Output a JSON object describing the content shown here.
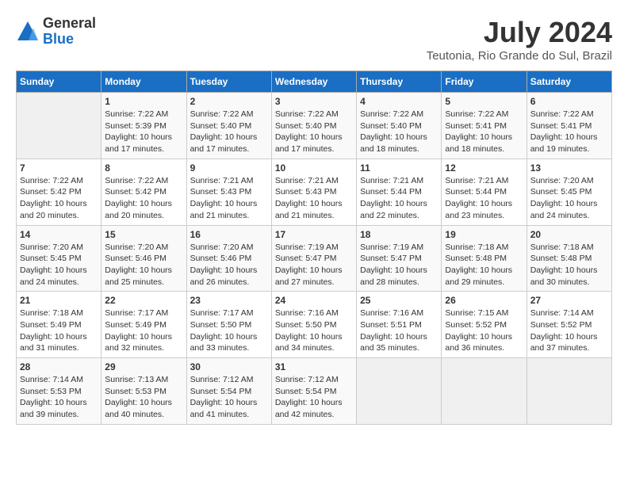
{
  "header": {
    "logo_general": "General",
    "logo_blue": "Blue",
    "month_year": "July 2024",
    "location": "Teutonia, Rio Grande do Sul, Brazil"
  },
  "weekdays": [
    "Sunday",
    "Monday",
    "Tuesday",
    "Wednesday",
    "Thursday",
    "Friday",
    "Saturday"
  ],
  "weeks": [
    [
      {
        "day": "",
        "empty": true
      },
      {
        "day": "1",
        "sunrise": "Sunrise: 7:22 AM",
        "sunset": "Sunset: 5:39 PM",
        "daylight": "Daylight: 10 hours and 17 minutes."
      },
      {
        "day": "2",
        "sunrise": "Sunrise: 7:22 AM",
        "sunset": "Sunset: 5:40 PM",
        "daylight": "Daylight: 10 hours and 17 minutes."
      },
      {
        "day": "3",
        "sunrise": "Sunrise: 7:22 AM",
        "sunset": "Sunset: 5:40 PM",
        "daylight": "Daylight: 10 hours and 17 minutes."
      },
      {
        "day": "4",
        "sunrise": "Sunrise: 7:22 AM",
        "sunset": "Sunset: 5:40 PM",
        "daylight": "Daylight: 10 hours and 18 minutes."
      },
      {
        "day": "5",
        "sunrise": "Sunrise: 7:22 AM",
        "sunset": "Sunset: 5:41 PM",
        "daylight": "Daylight: 10 hours and 18 minutes."
      },
      {
        "day": "6",
        "sunrise": "Sunrise: 7:22 AM",
        "sunset": "Sunset: 5:41 PM",
        "daylight": "Daylight: 10 hours and 19 minutes."
      }
    ],
    [
      {
        "day": "7",
        "sunrise": "Sunrise: 7:22 AM",
        "sunset": "Sunset: 5:42 PM",
        "daylight": "Daylight: 10 hours and 20 minutes."
      },
      {
        "day": "8",
        "sunrise": "Sunrise: 7:22 AM",
        "sunset": "Sunset: 5:42 PM",
        "daylight": "Daylight: 10 hours and 20 minutes."
      },
      {
        "day": "9",
        "sunrise": "Sunrise: 7:21 AM",
        "sunset": "Sunset: 5:43 PM",
        "daylight": "Daylight: 10 hours and 21 minutes."
      },
      {
        "day": "10",
        "sunrise": "Sunrise: 7:21 AM",
        "sunset": "Sunset: 5:43 PM",
        "daylight": "Daylight: 10 hours and 21 minutes."
      },
      {
        "day": "11",
        "sunrise": "Sunrise: 7:21 AM",
        "sunset": "Sunset: 5:44 PM",
        "daylight": "Daylight: 10 hours and 22 minutes."
      },
      {
        "day": "12",
        "sunrise": "Sunrise: 7:21 AM",
        "sunset": "Sunset: 5:44 PM",
        "daylight": "Daylight: 10 hours and 23 minutes."
      },
      {
        "day": "13",
        "sunrise": "Sunrise: 7:20 AM",
        "sunset": "Sunset: 5:45 PM",
        "daylight": "Daylight: 10 hours and 24 minutes."
      }
    ],
    [
      {
        "day": "14",
        "sunrise": "Sunrise: 7:20 AM",
        "sunset": "Sunset: 5:45 PM",
        "daylight": "Daylight: 10 hours and 24 minutes."
      },
      {
        "day": "15",
        "sunrise": "Sunrise: 7:20 AM",
        "sunset": "Sunset: 5:46 PM",
        "daylight": "Daylight: 10 hours and 25 minutes."
      },
      {
        "day": "16",
        "sunrise": "Sunrise: 7:20 AM",
        "sunset": "Sunset: 5:46 PM",
        "daylight": "Daylight: 10 hours and 26 minutes."
      },
      {
        "day": "17",
        "sunrise": "Sunrise: 7:19 AM",
        "sunset": "Sunset: 5:47 PM",
        "daylight": "Daylight: 10 hours and 27 minutes."
      },
      {
        "day": "18",
        "sunrise": "Sunrise: 7:19 AM",
        "sunset": "Sunset: 5:47 PM",
        "daylight": "Daylight: 10 hours and 28 minutes."
      },
      {
        "day": "19",
        "sunrise": "Sunrise: 7:18 AM",
        "sunset": "Sunset: 5:48 PM",
        "daylight": "Daylight: 10 hours and 29 minutes."
      },
      {
        "day": "20",
        "sunrise": "Sunrise: 7:18 AM",
        "sunset": "Sunset: 5:48 PM",
        "daylight": "Daylight: 10 hours and 30 minutes."
      }
    ],
    [
      {
        "day": "21",
        "sunrise": "Sunrise: 7:18 AM",
        "sunset": "Sunset: 5:49 PM",
        "daylight": "Daylight: 10 hours and 31 minutes."
      },
      {
        "day": "22",
        "sunrise": "Sunrise: 7:17 AM",
        "sunset": "Sunset: 5:49 PM",
        "daylight": "Daylight: 10 hours and 32 minutes."
      },
      {
        "day": "23",
        "sunrise": "Sunrise: 7:17 AM",
        "sunset": "Sunset: 5:50 PM",
        "daylight": "Daylight: 10 hours and 33 minutes."
      },
      {
        "day": "24",
        "sunrise": "Sunrise: 7:16 AM",
        "sunset": "Sunset: 5:50 PM",
        "daylight": "Daylight: 10 hours and 34 minutes."
      },
      {
        "day": "25",
        "sunrise": "Sunrise: 7:16 AM",
        "sunset": "Sunset: 5:51 PM",
        "daylight": "Daylight: 10 hours and 35 minutes."
      },
      {
        "day": "26",
        "sunrise": "Sunrise: 7:15 AM",
        "sunset": "Sunset: 5:52 PM",
        "daylight": "Daylight: 10 hours and 36 minutes."
      },
      {
        "day": "27",
        "sunrise": "Sunrise: 7:14 AM",
        "sunset": "Sunset: 5:52 PM",
        "daylight": "Daylight: 10 hours and 37 minutes."
      }
    ],
    [
      {
        "day": "28",
        "sunrise": "Sunrise: 7:14 AM",
        "sunset": "Sunset: 5:53 PM",
        "daylight": "Daylight: 10 hours and 39 minutes."
      },
      {
        "day": "29",
        "sunrise": "Sunrise: 7:13 AM",
        "sunset": "Sunset: 5:53 PM",
        "daylight": "Daylight: 10 hours and 40 minutes."
      },
      {
        "day": "30",
        "sunrise": "Sunrise: 7:12 AM",
        "sunset": "Sunset: 5:54 PM",
        "daylight": "Daylight: 10 hours and 41 minutes."
      },
      {
        "day": "31",
        "sunrise": "Sunrise: 7:12 AM",
        "sunset": "Sunset: 5:54 PM",
        "daylight": "Daylight: 10 hours and 42 minutes."
      },
      {
        "day": "",
        "empty": true
      },
      {
        "day": "",
        "empty": true
      },
      {
        "day": "",
        "empty": true
      }
    ]
  ]
}
